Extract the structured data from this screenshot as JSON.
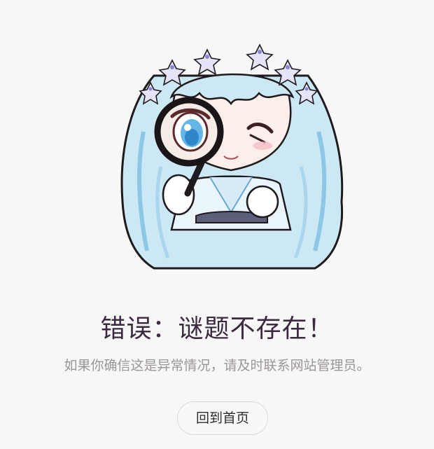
{
  "error": {
    "title": "错误：谜题不存在！",
    "message": "如果你确信这是异常情况，请及时联系网站管理员。",
    "home_button_label": "回到首页"
  },
  "illustration": {
    "icon": "chibi-girl-magnifying-glass-illustration",
    "hair_color": "#bfe2f2",
    "flower_color": "#8a86d6",
    "outline_color": "#1f1a1d"
  }
}
